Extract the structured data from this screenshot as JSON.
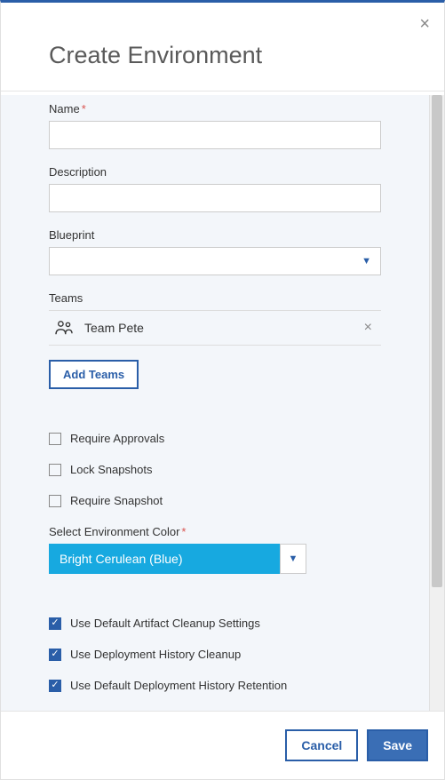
{
  "modal": {
    "title": "Create Environment",
    "name_label": "Name",
    "description_label": "Description",
    "blueprint_label": "Blueprint",
    "teams_label": "Teams",
    "add_teams_label": "Add Teams",
    "color_label": "Select Environment Color"
  },
  "teams": {
    "selected": "Team Pete"
  },
  "checkboxes": {
    "require_approvals": {
      "label": "Require Approvals",
      "checked": false
    },
    "lock_snapshots": {
      "label": "Lock Snapshots",
      "checked": false
    },
    "require_snapshot": {
      "label": "Require Snapshot",
      "checked": false
    },
    "use_default_artifact_cleanup": {
      "label": "Use Default Artifact Cleanup Settings",
      "checked": true
    },
    "use_deployment_history_cleanup": {
      "label": "Use Deployment History Cleanup",
      "checked": true
    },
    "use_default_history_retention": {
      "label": "Use Default Deployment History Retention",
      "checked": true
    }
  },
  "color": {
    "selected": "Bright Cerulean (Blue)",
    "hex": "#17a9e0"
  },
  "footer": {
    "cancel": "Cancel",
    "save": "Save"
  }
}
